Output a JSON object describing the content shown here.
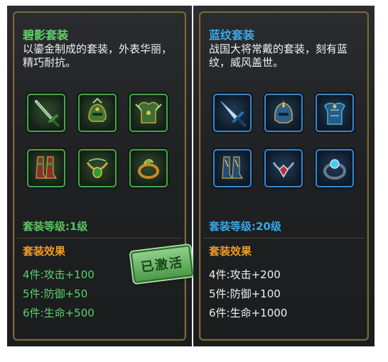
{
  "panels": [
    {
      "title": "碧影套装",
      "description": "以鎏金制成的套装，外表华丽，精巧耐抗。",
      "slots": [
        "sword-icon",
        "helmet-icon",
        "armor-icon",
        "boots-icon",
        "necklace-icon",
        "ring-icon"
      ],
      "level": "套装等级:1级",
      "effects_label": "套装效果",
      "effects": [
        "4件:攻击+100",
        "5件:防御+50",
        "6件:生命+500"
      ],
      "stamp": "已激活",
      "accent": "#5fd46a"
    },
    {
      "title": "蓝纹套装",
      "description": "战国大将常戴的套装，刻有蓝纹，威风盖世。",
      "slots": [
        "sword-icon",
        "helmet-icon",
        "armor-icon",
        "boots-icon",
        "necklace-icon",
        "ring-icon"
      ],
      "level": "套装等级:20级",
      "effects_label": "套装效果",
      "effects": [
        "4件:攻击+200",
        "5件:防御+100",
        "6件:生命+1000"
      ],
      "accent": "#3aa9ea"
    }
  ]
}
